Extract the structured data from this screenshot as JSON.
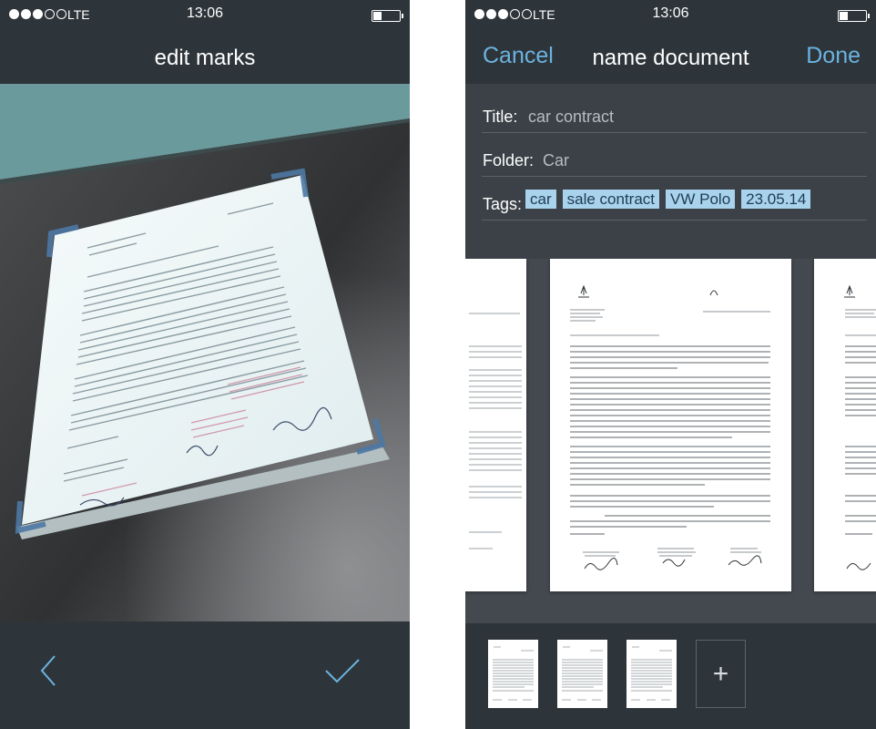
{
  "status": {
    "carrier": "LTE",
    "time": "13:06"
  },
  "left_screen": {
    "title": "edit marks",
    "back_icon": "chevron-left-icon",
    "confirm_icon": "checkmark-icon"
  },
  "right_screen": {
    "title": "name document",
    "cancel_label": "Cancel",
    "done_label": "Done",
    "fields": {
      "title_label": "Title:",
      "title_value": "car contract",
      "folder_label": "Folder:",
      "folder_value": "Car",
      "tags_label": "Tags:",
      "tags": [
        "car",
        "sale contract",
        "VW Polo",
        "23.05.14"
      ]
    },
    "add_page_label": "+",
    "thumbnail_count": 3
  },
  "colors": {
    "accent": "#6bb3e0",
    "tag_background": "#a9d2ed",
    "bar_background": "#2e353a"
  }
}
